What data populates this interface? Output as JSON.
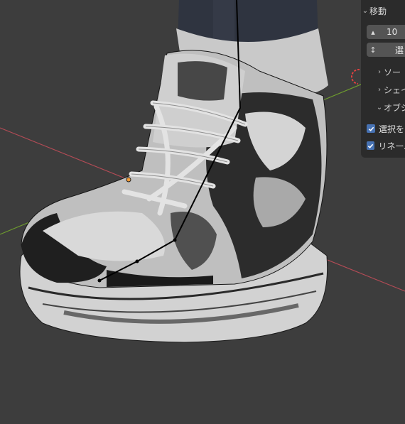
{
  "panel": {
    "section_title": "移動",
    "count_value": "10",
    "select_field_label": "選",
    "sub_sections": [
      "ソー",
      "シェイ",
      "オブジ"
    ],
    "options": [
      {
        "label": "選択を",
        "checked": true
      },
      {
        "label": "リネーム",
        "checked": true
      }
    ]
  },
  "colors": {
    "background": "#3d3d3d",
    "panel_bg": "#2b2b2b",
    "axis_x": "#b14b55",
    "axis_y": "#6d9a2e",
    "checkbox": "#4772b3"
  },
  "icons": [
    "chevron-down-icon",
    "chevron-right-icon",
    "up-down-arrow-icon",
    "checkmark-icon",
    "origin-dot-icon"
  ]
}
